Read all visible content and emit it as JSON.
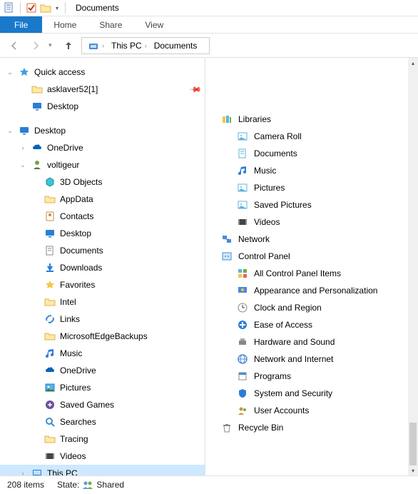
{
  "window": {
    "title": "Documents"
  },
  "ribbon": {
    "file": "File",
    "tabs": [
      "Home",
      "Share",
      "View"
    ]
  },
  "breadcrumb": [
    "This PC",
    "Documents"
  ],
  "tree": {
    "quick_access": {
      "label": "Quick access",
      "items": [
        {
          "label": "asklaver52[1]",
          "icon": "folder",
          "pinned": true
        },
        {
          "label": "Desktop",
          "icon": "desktop",
          "pinned": false
        }
      ]
    },
    "desktop": {
      "label": "Desktop",
      "items": [
        {
          "label": "OneDrive",
          "icon": "onedrive",
          "expand": "closed"
        },
        {
          "label": "voltigeur",
          "icon": "user",
          "expand": "open",
          "items": [
            {
              "label": "3D Objects",
              "icon": "3d"
            },
            {
              "label": "AppData",
              "icon": "folder"
            },
            {
              "label": "Contacts",
              "icon": "contacts"
            },
            {
              "label": "Desktop",
              "icon": "desktop"
            },
            {
              "label": "Documents",
              "icon": "documents"
            },
            {
              "label": "Downloads",
              "icon": "downloads"
            },
            {
              "label": "Favorites",
              "icon": "star"
            },
            {
              "label": "Intel",
              "icon": "folder"
            },
            {
              "label": "Links",
              "icon": "links"
            },
            {
              "label": "MicrosoftEdgeBackups",
              "icon": "folder"
            },
            {
              "label": "Music",
              "icon": "music"
            },
            {
              "label": "OneDrive",
              "icon": "onedrive"
            },
            {
              "label": "Pictures",
              "icon": "pictures"
            },
            {
              "label": "Saved Games",
              "icon": "games"
            },
            {
              "label": "Searches",
              "icon": "search"
            },
            {
              "label": "Tracing",
              "icon": "folder"
            },
            {
              "label": "Videos",
              "icon": "videos"
            }
          ]
        },
        {
          "label": "This PC",
          "icon": "thispc",
          "expand": "closed",
          "selected": true
        }
      ]
    }
  },
  "content": [
    {
      "label": "Libraries",
      "icon": "libraries",
      "sub": false
    },
    {
      "label": "Camera Roll",
      "icon": "image-lib",
      "sub": true
    },
    {
      "label": "Documents",
      "icon": "doc-lib",
      "sub": true
    },
    {
      "label": "Music",
      "icon": "music",
      "sub": true
    },
    {
      "label": "Pictures",
      "icon": "image-lib",
      "sub": true
    },
    {
      "label": "Saved Pictures",
      "icon": "image-lib",
      "sub": true
    },
    {
      "label": "Videos",
      "icon": "videos",
      "sub": true
    },
    {
      "label": "Network",
      "icon": "network",
      "sub": false
    },
    {
      "label": "Control Panel",
      "icon": "control-panel",
      "sub": false
    },
    {
      "label": "All Control Panel Items",
      "icon": "cp-all",
      "sub": true
    },
    {
      "label": "Appearance and Personalization",
      "icon": "cp-appearance",
      "sub": true
    },
    {
      "label": "Clock and Region",
      "icon": "cp-clock",
      "sub": true
    },
    {
      "label": "Ease of Access",
      "icon": "cp-ease",
      "sub": true
    },
    {
      "label": "Hardware and Sound",
      "icon": "cp-hardware",
      "sub": true
    },
    {
      "label": "Network and Internet",
      "icon": "cp-network",
      "sub": true
    },
    {
      "label": "Programs",
      "icon": "cp-programs",
      "sub": true
    },
    {
      "label": "System and Security",
      "icon": "cp-security",
      "sub": true
    },
    {
      "label": "User Accounts",
      "icon": "cp-users",
      "sub": true
    },
    {
      "label": "Recycle Bin",
      "icon": "recycle",
      "sub": false
    }
  ],
  "status": {
    "count_label": "208 items",
    "state_prefix": "State:",
    "state_value": "Shared"
  },
  "colors": {
    "accent": "#1979ca",
    "selection": "#cde8ff"
  }
}
